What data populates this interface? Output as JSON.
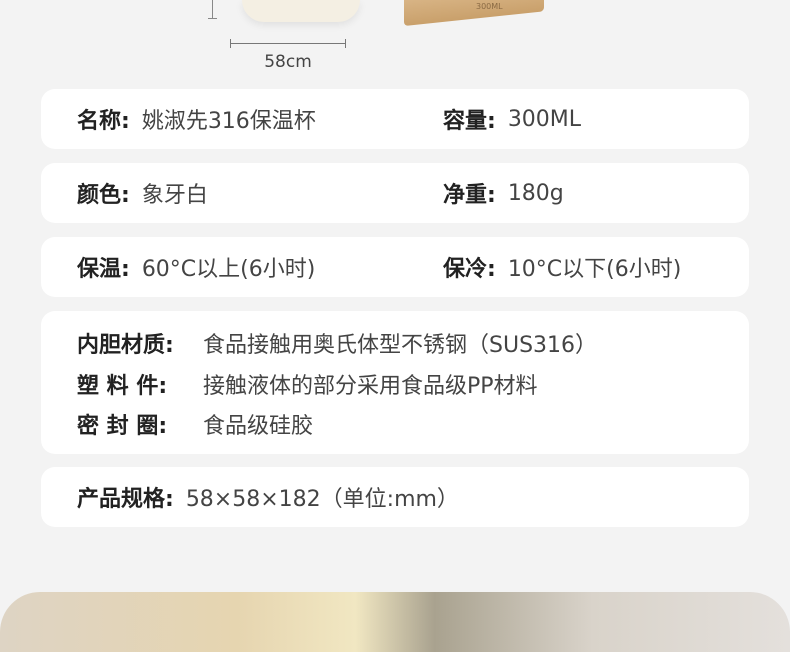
{
  "dimension": {
    "label": "58cm"
  },
  "product_box": {
    "label": "300ML"
  },
  "specs": [
    {
      "key": "名称:",
      "value": "姚淑先316保温杯",
      "key2": "容量:",
      "value2": "300ML"
    },
    {
      "key": "颜色:",
      "value": "象牙白",
      "key2": "净重:",
      "value2": "180g"
    },
    {
      "key": "保温:",
      "value": "60°C以上(6小时)",
      "key2": "保冷:",
      "value2": "10°C以下(6小时)"
    }
  ],
  "materials": [
    {
      "key": "内胆材质:",
      "value": "食品接触用奥氏体型不锈钢（SUS316）"
    },
    {
      "key": "塑 料 件:",
      "value": "接触液体的部分采用食品级PP材料"
    },
    {
      "key": "密 封 圈:",
      "value": "食品级硅胶"
    }
  ],
  "size": {
    "key": "产品规格:",
    "value": "58×58×182（单位:mm）"
  },
  "colors": {
    "background": "#f3f3f3",
    "card": "#ffffff",
    "cup": "#f4efe3",
    "box": "#c9a06b"
  }
}
